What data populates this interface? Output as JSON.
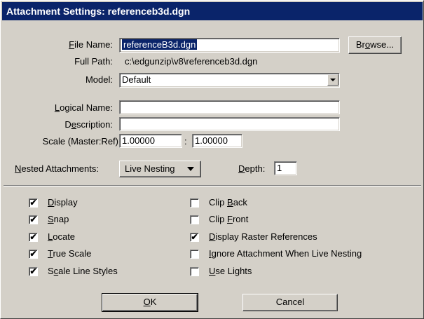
{
  "window": {
    "title": "Attachment Settings: referenceb3d.dgn"
  },
  "file_name": {
    "label_pre": "",
    "label_u": "F",
    "label_post": "ile Name:",
    "value": "referenceB3d.dgn"
  },
  "browse_button": {
    "pre": "Br",
    "u": "o",
    "post": "wse..."
  },
  "full_path": {
    "label": "Full Path:",
    "value": "c:\\edgunzip\\v8\\referenceb3d.dgn"
  },
  "model": {
    "label": "Model:",
    "value": "Default"
  },
  "logical_name": {
    "label_u": "L",
    "label_post": "ogical Name:",
    "value": ""
  },
  "description": {
    "label_pre": "D",
    "label_u": "e",
    "label_post": "scription:",
    "value": ""
  },
  "scale": {
    "label": "Scale (Master:Ref)",
    "master": "1.00000",
    "separator": ":",
    "ref": "1.00000"
  },
  "nested": {
    "label_u": "N",
    "label_post": "ested Attachments:",
    "value": "Live Nesting"
  },
  "depth": {
    "label_u": "D",
    "label_post": "epth:",
    "value": "1"
  },
  "left_checks": [
    {
      "pre": "",
      "u": "D",
      "post": "isplay",
      "checked": true
    },
    {
      "pre": "",
      "u": "S",
      "post": "nap",
      "checked": true
    },
    {
      "pre": "",
      "u": "L",
      "post": "ocate",
      "checked": true
    },
    {
      "pre": "",
      "u": "T",
      "post": "rue Scale",
      "checked": true
    },
    {
      "pre": "S",
      "u": "c",
      "post": "ale Line Styles",
      "checked": true
    }
  ],
  "right_checks": [
    {
      "pre": "Clip ",
      "u": "B",
      "post": "ack",
      "checked": false
    },
    {
      "pre": "Clip ",
      "u": "F",
      "post": "ront",
      "checked": false
    },
    {
      "pre": "",
      "u": "D",
      "post": "isplay Raster References",
      "checked": true
    },
    {
      "pre": "",
      "u": "I",
      "post": "gnore Attachment When Live Nesting",
      "checked": false
    },
    {
      "pre": "",
      "u": "U",
      "post": "se Lights",
      "checked": false
    }
  ],
  "ok_button": {
    "u": "O",
    "post": "K"
  },
  "cancel_button": {
    "label": "Cancel"
  },
  "check_glyph": "✔"
}
